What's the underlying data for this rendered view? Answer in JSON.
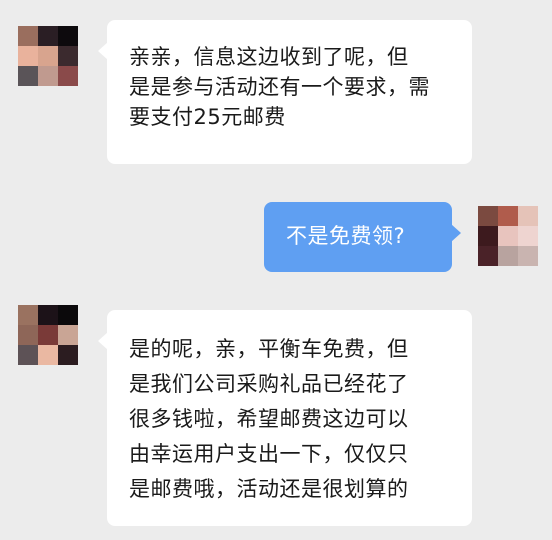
{
  "messages": [
    {
      "side": "left",
      "lines": [
        "亲亲，信息这边收到了呢，但",
        "是是参与活动还有一个要求，需",
        "要支付25元邮费"
      ]
    },
    {
      "side": "right",
      "lines": [
        "不是免费领?"
      ]
    },
    {
      "side": "left",
      "lines": [
        "是的呢，亲，平衡车免费，但",
        "是我们公司采购礼品已经花了",
        "很多钱啦，希望邮费这边可以",
        "由幸运用户支出一下，仅仅只",
        "是邮费哦，活动还是很划算的"
      ]
    }
  ],
  "avatars": {
    "left_1": [
      "#9a6e5e",
      "#2a1e24",
      "#0d0a0d",
      "#e9b29c",
      "#d8a48e",
      "#3b2a2e",
      "#5a5458",
      "#c09a8f",
      "#8a4a4a"
    ],
    "right_1": [
      "#7b4a40",
      "#b05c4c",
      "#e5c3b8",
      "#3d1a1e",
      "#e8c4be",
      "#eed4d0",
      "#4a2228",
      "#b8a39f",
      "#c9b4b0"
    ],
    "left_2": [
      "#9a7260",
      "#1c1218",
      "#0b090b",
      "#8e6658",
      "#7a3a38",
      "#c9a595",
      "#5d5256",
      "#eab8a2",
      "#2b1c20"
    ]
  }
}
